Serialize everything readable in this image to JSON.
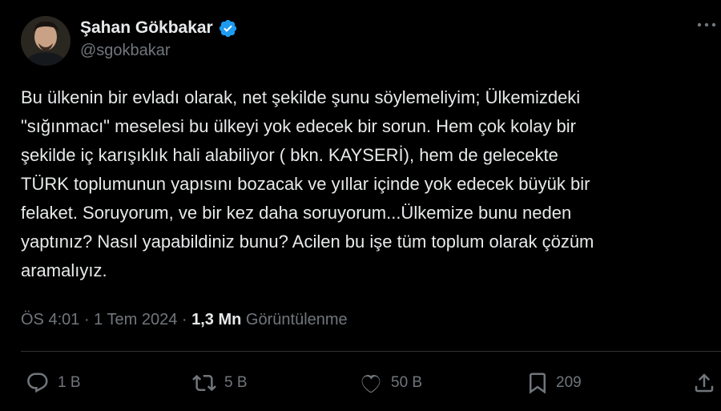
{
  "author": {
    "display_name": "Şahan Gökbakar",
    "handle": "@sgokbakar",
    "verified_icon": "verified-badge-icon",
    "verified_color": "#1d9bf0"
  },
  "tweet": {
    "text": "Bu ülkenin bir evladı olarak, net şekilde şunu söylemeliyim; Ülkemizdeki\n\"sığınmacı\" meselesi bu ülkeyi yok edecek bir sorun. Hem çok kolay bir\nşekilde iç karışıklık hali alabiliyor ( bkn. KAYSERİ), hem de gelecekte\nTÜRK toplumunun yapısını bozacak ve yıllar içinde yok edecek büyük bir\nfelaket. Soruyorum, ve bir kez daha soruyorum...Ülkemize bunu neden\nyaptınız? Nasıl yapabildiniz bunu? Acilen bu işe tüm toplum olarak çözüm\naramalıyız.",
    "time": "ÖS 4:01",
    "date": "1 Tem 2024",
    "separator": " · ",
    "views_count": "1,3 Mn",
    "views_label": "Görüntülenme"
  },
  "actions": {
    "reply": {
      "icon": "reply-icon",
      "count": "1 B"
    },
    "retweet": {
      "icon": "retweet-icon",
      "count": "5 B"
    },
    "like": {
      "icon": "heart-icon",
      "count": "50 B"
    },
    "bookmark": {
      "icon": "bookmark-icon",
      "count": "209"
    },
    "share": {
      "icon": "share-icon"
    }
  },
  "theme": {
    "background": "#000000",
    "text": "#e7e9ea",
    "muted": "#71767b",
    "divider": "#2f3336"
  }
}
